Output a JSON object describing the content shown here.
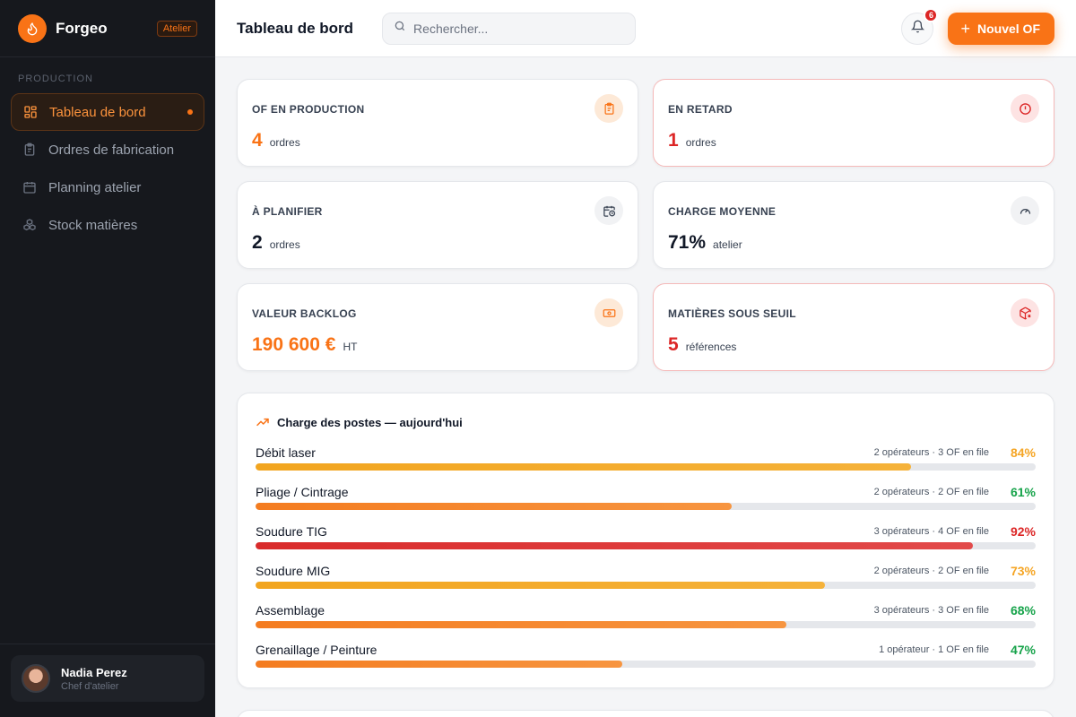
{
  "brand": {
    "name": "Forgeo",
    "badge": "Atelier"
  },
  "sidebar": {
    "section": "PRODUCTION",
    "items": [
      {
        "label": "Tableau de bord",
        "icon": "dashboard-icon",
        "active": true
      },
      {
        "label": "Ordres de fabrication",
        "icon": "clipboard-icon",
        "active": false
      },
      {
        "label": "Planning atelier",
        "icon": "calendar-icon",
        "active": false
      },
      {
        "label": "Stock matières",
        "icon": "boxes-icon",
        "active": false
      }
    ]
  },
  "user": {
    "name": "Nadia Perez",
    "role": "Chef d'atelier"
  },
  "header": {
    "title": "Tableau de bord",
    "search_placeholder": "Rechercher...",
    "notifications": "6",
    "new_button": "Nouvel OF"
  },
  "stats": [
    {
      "label": "OF EN PRODUCTION",
      "value": "4",
      "unit": "ordres",
      "icon": "clipboard-icon",
      "color": "#f97316",
      "alert": false
    },
    {
      "label": "EN RETARD",
      "value": "1",
      "unit": "ordres",
      "icon": "alert-circle-icon",
      "color": "#dc2626",
      "alert": true
    },
    {
      "label": "À PLANIFIER",
      "value": "2",
      "unit": "ordres",
      "icon": "calendar-clock-icon",
      "color": "#111827",
      "alert": false
    },
    {
      "label": "CHARGE MOYENNE",
      "value": "71%",
      "unit": "atelier",
      "icon": "gauge-icon",
      "color": "#111827",
      "alert": false
    },
    {
      "label": "VALEUR BACKLOG",
      "value": "190 600 €",
      "unit": "HT",
      "icon": "banknote-icon",
      "color": "#f97316",
      "alert": false
    },
    {
      "label": "MATIÈRES SOUS SEUIL",
      "value": "5",
      "unit": "références",
      "icon": "package-x-icon",
      "color": "#dc2626",
      "alert": true
    }
  ],
  "load": {
    "title": "Charge des postes — aujourd'hui",
    "rows": [
      {
        "name": "Débit laser",
        "meta": "2 opérateurs · 3 OF en file",
        "pct": "84%",
        "value": 84,
        "color": "#f5a524"
      },
      {
        "name": "Pliage / Cintrage",
        "meta": "2 opérateurs · 2 OF en file",
        "pct": "61%",
        "value": 61,
        "color": "#16a34a"
      },
      {
        "name": "Soudure TIG",
        "meta": "3 opérateurs · 4 OF en file",
        "pct": "92%",
        "value": 92,
        "color": "#dc2626"
      },
      {
        "name": "Soudure MIG",
        "meta": "2 opérateurs · 2 OF en file",
        "pct": "73%",
        "value": 73,
        "color": "#f5a524"
      },
      {
        "name": "Assemblage",
        "meta": "3 opérateurs · 3 OF en file",
        "pct": "68%",
        "value": 68,
        "color": "#16a34a"
      },
      {
        "name": "Grenaillage / Peinture",
        "meta": "1 opérateur · 1 OF en file",
        "pct": "47%",
        "value": 47,
        "color": "#16a34a"
      }
    ]
  },
  "colors": {
    "accent": "#f97316",
    "danger": "#dc2626",
    "warning": "#f5a524",
    "success": "#16a34a"
  }
}
